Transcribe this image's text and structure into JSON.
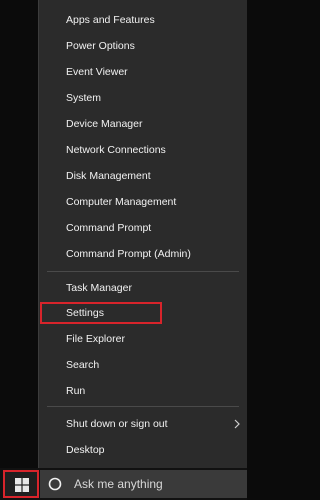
{
  "menu": {
    "group1": [
      {
        "label": "Apps and Features"
      },
      {
        "label": "Power Options"
      },
      {
        "label": "Event Viewer"
      },
      {
        "label": "System"
      },
      {
        "label": "Device Manager"
      },
      {
        "label": "Network Connections"
      },
      {
        "label": "Disk Management"
      },
      {
        "label": "Computer Management"
      },
      {
        "label": "Command Prompt"
      },
      {
        "label": "Command Prompt (Admin)"
      }
    ],
    "group2": [
      {
        "label": "Task Manager"
      },
      {
        "label": "Settings"
      },
      {
        "label": "File Explorer"
      },
      {
        "label": "Search"
      },
      {
        "label": "Run"
      }
    ],
    "group3": [
      {
        "label": "Shut down or sign out",
        "has_submenu": true
      },
      {
        "label": "Desktop"
      }
    ]
  },
  "taskbar": {
    "search_placeholder": "Ask me anything"
  },
  "icons": {
    "start": "windows-logo-icon",
    "search": "cortana-circle-icon",
    "submenu": "chevron-right-icon"
  },
  "colors": {
    "menu_background": "#2b2b2b",
    "text": "#f2f2f2",
    "highlight": "#d8242b",
    "taskbar": "#111111",
    "search_box": "#3a3a3a"
  }
}
